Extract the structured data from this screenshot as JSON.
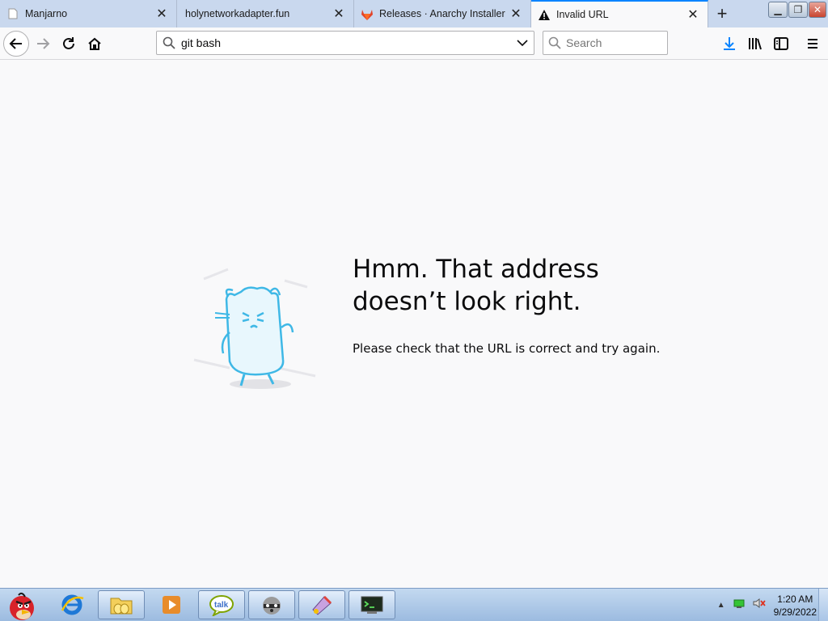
{
  "tabs": [
    {
      "label": "Manjarno",
      "icon": "page-icon"
    },
    {
      "label": "holynetworkadapter.fun",
      "icon": ""
    },
    {
      "label": "Releases · Anarchy Installer",
      "icon": "gitlab-icon"
    },
    {
      "label": "Invalid URL",
      "icon": "warning-icon",
      "active": true
    }
  ],
  "toolbar": {
    "url_value": "git bash",
    "search_placeholder": "Search"
  },
  "error": {
    "title_line1": "Hmm. That address",
    "title_line2": "doesn’t look right.",
    "message": "Please check that the URL is correct and try again."
  },
  "taskbar": {
    "time": "1:20 AM",
    "date": "9/29/2022",
    "apps": [
      "angry-birds-start",
      "internet-explorer",
      "file-explorer",
      "media-player",
      "google-talk",
      "raccoon-app",
      "paint-app",
      "terminal-app"
    ]
  },
  "colors": {
    "accent": "#0a84ff",
    "tabstrip": "#c9d8ee",
    "illustration": "#3fb8e6"
  }
}
